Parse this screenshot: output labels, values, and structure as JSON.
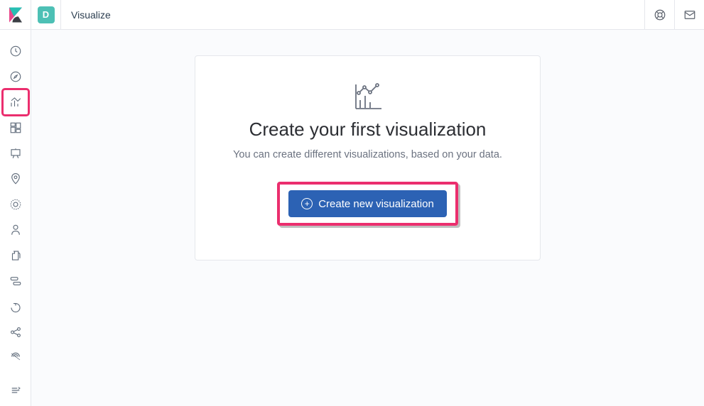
{
  "header": {
    "avatar_letter": "D",
    "breadcrumb": "Visualize"
  },
  "sidebar": {
    "items": [
      {
        "name": "recent"
      },
      {
        "name": "discover"
      },
      {
        "name": "visualize",
        "highlighted": true
      },
      {
        "name": "dashboard"
      },
      {
        "name": "canvas"
      },
      {
        "name": "maps"
      },
      {
        "name": "ml"
      },
      {
        "name": "infrastructure"
      },
      {
        "name": "logs"
      },
      {
        "name": "apm"
      },
      {
        "name": "uptime"
      },
      {
        "name": "graph"
      },
      {
        "name": "siem"
      }
    ]
  },
  "card": {
    "title": "Create your first visualization",
    "subtitle": "You can create different visualizations, based on your data.",
    "button_label": "Create new visualization"
  }
}
